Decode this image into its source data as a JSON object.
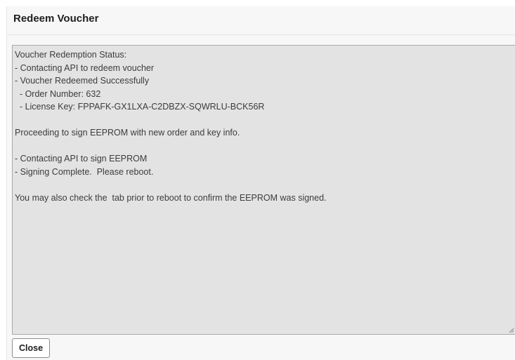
{
  "dialog": {
    "title": "Redeem Voucher",
    "status_text": "Voucher Redemption Status:\n- Contacting API to redeem voucher\n- Voucher Redeemed Successfully\n  - Order Number: 632\n  - License Key: FPPAFK-GX1LXA-C2DBZX-SQWRLU-BCK56R\n\nProceeding to sign EEPROM with new order and key info.\n\n- Contacting API to sign EEPROM\n- Signing Complete.  Please reboot.\n\nYou may also check the  tab prior to reboot to confirm the EEPROM was signed.",
    "close_label": "Close"
  },
  "colors": {
    "dialog_background": "#f7f7f7",
    "text_area_background": "#e3e3e3",
    "text_area_border": "#a9a9a9",
    "text_color": "#3c3c3c"
  },
  "icons": {
    "resize_grip": "resize-grip-icon"
  }
}
